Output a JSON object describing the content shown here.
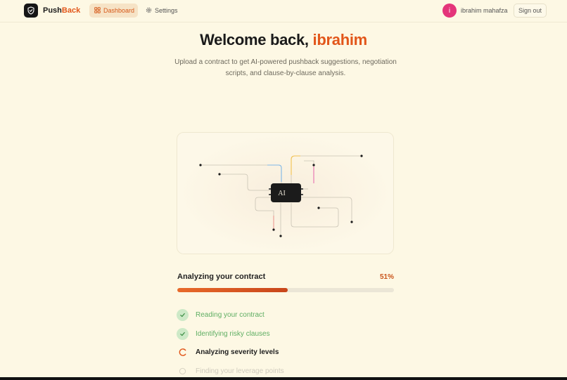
{
  "nav": {
    "brand_main": "Push",
    "brand_accent": "Back",
    "tabs": [
      {
        "label": "Dashboard",
        "icon": "grid-icon",
        "active": true
      },
      {
        "label": "Settings",
        "icon": "gear-icon",
        "active": false
      }
    ],
    "user": {
      "initial": "i",
      "name": "ibrahim mahafza",
      "avatar_color": "#e4357a"
    },
    "signout_label": "Sign out"
  },
  "hero": {
    "title_prefix": "Welcome back,",
    "title_name": "ibrahim",
    "subtitle": "Upload a contract to get AI-powered pushback suggestions, negotiation scripts, and clause-by-clause analysis."
  },
  "illustration": {
    "chip_label": "AI"
  },
  "progress": {
    "label": "Analyzing your contract",
    "percent_text": "51%",
    "value": 51
  },
  "steps": [
    {
      "label": "Reading your contract",
      "status": "done"
    },
    {
      "label": "Identifying risky clauses",
      "status": "done"
    },
    {
      "label": "Analyzing severity levels",
      "status": "active"
    },
    {
      "label": "Finding your leverage points",
      "status": "pending"
    }
  ],
  "colors": {
    "accent": "#e2561a",
    "background": "#fdf8e4",
    "success": "#5fae63"
  }
}
